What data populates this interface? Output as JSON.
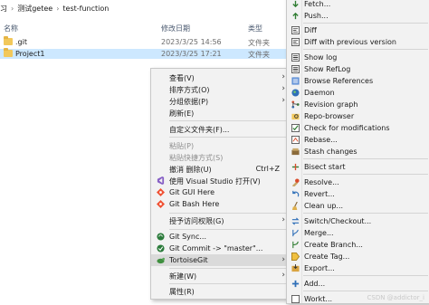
{
  "explorer": {
    "breadcrumb": [
      "习",
      "测试getee",
      "test-function"
    ],
    "columns": {
      "name": "名称",
      "date": "修改日期",
      "type": "类型"
    },
    "files": [
      {
        "name": ".git",
        "date": "2023/3/25 14:56",
        "type": "文件夹",
        "selected": false
      },
      {
        "name": "Project1",
        "date": "2023/3/25 17:21",
        "type": "文件夹",
        "selected": true
      }
    ]
  },
  "context_menu": {
    "items": [
      {
        "label": "查看(V)",
        "submenu": true
      },
      {
        "label": "排序方式(O)",
        "submenu": true
      },
      {
        "label": "分组依据(P)",
        "submenu": true
      },
      {
        "label": "刷新(E)"
      },
      {
        "label": "自定义文件夹(F)..."
      },
      {
        "label": "粘贴(P)",
        "disabled": true
      },
      {
        "label": "粘贴快捷方式(S)",
        "disabled": true
      },
      {
        "label": "撤消 删除(U)",
        "shortcut": "Ctrl+Z"
      },
      {
        "label": "使用 Visual Studio 打开(V)",
        "icon": "visual-studio-icon"
      },
      {
        "label": "Git GUI Here",
        "icon": "git-gui-icon"
      },
      {
        "label": "Git Bash Here",
        "icon": "git-bash-icon"
      },
      {
        "label": "授予访问权限(G)",
        "submenu": true
      },
      {
        "label": "Git Sync...",
        "icon": "git-sync-icon"
      },
      {
        "label": "Git Commit -> \"master\"...",
        "icon": "git-commit-icon"
      },
      {
        "label": "TortoiseGit",
        "submenu": true,
        "icon": "tortoisegit-icon"
      },
      {
        "label": "新建(W)",
        "submenu": true
      },
      {
        "label": "属性(R)"
      }
    ]
  },
  "tortoise_submenu": {
    "items": [
      {
        "label": "Fetch...",
        "icon": "fetch-icon"
      },
      {
        "label": "Push...",
        "icon": "push-icon"
      },
      {
        "label": "Diff",
        "icon": "diff-icon"
      },
      {
        "label": "Diff with previous version",
        "icon": "diff-previous-icon"
      },
      {
        "label": "Show log",
        "icon": "show-log-icon"
      },
      {
        "label": "Show RefLog",
        "icon": "reflog-icon"
      },
      {
        "label": "Browse References",
        "icon": "browse-references-icon"
      },
      {
        "label": "Daemon",
        "icon": "daemon-icon"
      },
      {
        "label": "Revision graph",
        "icon": "revision-graph-icon"
      },
      {
        "label": "Repo-browser",
        "icon": "repo-browser-icon"
      },
      {
        "label": "Check for modifications",
        "icon": "check-modifications-icon"
      },
      {
        "label": "Rebase...",
        "icon": "rebase-icon"
      },
      {
        "label": "Stash changes",
        "icon": "stash-icon"
      },
      {
        "label": "Bisect start",
        "icon": "bisect-icon"
      },
      {
        "label": "Resolve...",
        "icon": "resolve-icon"
      },
      {
        "label": "Revert...",
        "icon": "revert-icon"
      },
      {
        "label": "Clean up...",
        "icon": "clean-up-icon"
      },
      {
        "label": "Switch/Checkout...",
        "icon": "switch-checkout-icon"
      },
      {
        "label": "Merge...",
        "icon": "merge-icon"
      },
      {
        "label": "Create Branch...",
        "icon": "create-branch-icon"
      },
      {
        "label": "Create Tag...",
        "icon": "create-tag-icon"
      },
      {
        "label": "Export...",
        "icon": "export-icon"
      },
      {
        "label": "Add...",
        "icon": "add-icon"
      },
      {
        "label": "Workt...",
        "icon": "worktree-icon"
      }
    ]
  },
  "watermark": "CSDN @addictor_i"
}
